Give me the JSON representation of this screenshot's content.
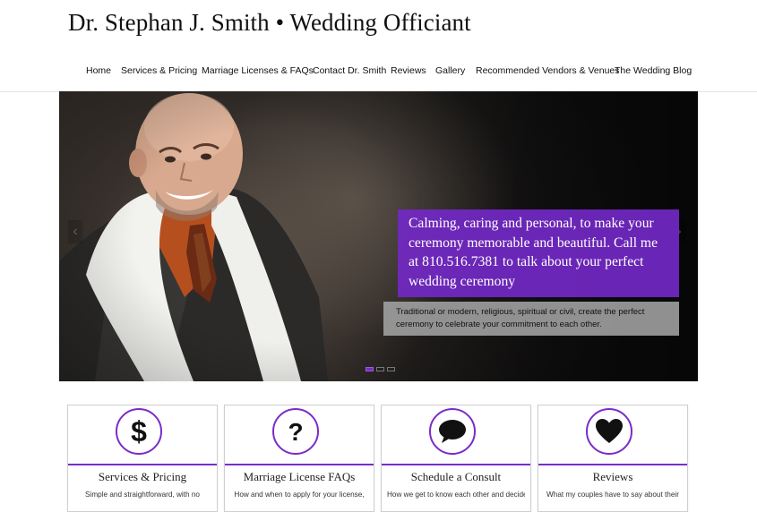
{
  "site": {
    "title": "Dr. Stephan J. Smith • Wedding Officiant"
  },
  "nav": {
    "items": [
      {
        "label": "Home"
      },
      {
        "label": "Services & Pricing"
      },
      {
        "label": "Marriage Licenses & FAQs"
      },
      {
        "label": "Contact Dr. Smith"
      },
      {
        "label": "Reviews"
      },
      {
        "label": "Gallery"
      },
      {
        "label": "Recommended Vendors & Venues"
      },
      {
        "label": "The Wedding Blog"
      }
    ]
  },
  "slider": {
    "prev_arrow": "‹",
    "next_arrow": "›",
    "headline": "Calming, caring and personal, to make your ceremony memorable and beautiful. Call me at 810.516.7381 to talk about your perfect wedding ceremony",
    "subtext": "Traditional or modern, religious, spiritual or civil, create the perfect ceremony to celebrate your commitment to each other.",
    "slide_count": 3,
    "active_slide": 1
  },
  "cards": [
    {
      "icon": "dollar-icon",
      "title": "Services & Pricing",
      "description": "Simple and straightforward, with no"
    },
    {
      "icon": "question-icon",
      "title": "Marriage License FAQs",
      "description": "How and when to apply for your license,"
    },
    {
      "icon": "chat-bubble-icon",
      "title": "Schedule a Consult",
      "description": "How we get to know each other and decide"
    },
    {
      "icon": "heart-icon",
      "title": "Reviews",
      "description": "What my couples have to say about their"
    }
  ],
  "colors": {
    "accent": "#7a2cc9",
    "caption_bg": "#7228c4",
    "subcaption_bg": "#a0a0a0"
  }
}
